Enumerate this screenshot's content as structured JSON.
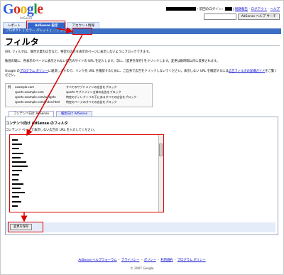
{
  "header": {
    "logo_text_g": "G",
    "logo_text_o1": "o",
    "logo_text_o2": "o",
    "logo_text_g2": "g",
    "logo_text_l": "l",
    "logo_text_e": "e",
    "logo_sub": "AdSense",
    "user_suffix": "・前回のログイン：",
    "links": [
      "問題報告",
      "ログアウト",
      "ヘルプ"
    ],
    "search_button": "AdSense ヘルプ サーチ"
  },
  "tabs": [
    {
      "label": "レポート",
      "active": false
    },
    {
      "label": "AdSense 設定",
      "active": true
    },
    {
      "label": "アカウント情報",
      "active": false
    }
  ],
  "subnav": {
    "items": [
      "プロダクト",
      "カラー パレット",
      "…",
      "フィルタ"
    ],
    "current_index": 3
  },
  "page": {
    "title": "フィルタ",
    "para1": "URL フィルタは、競合企業の広告など、特定の広告を表示のページに表示しないようにブロックできます。",
    "para2": "数週の間に、各表示のページに表示されない広告のサイトの URL を記入します。次に、[変更を保存] をクリックします。変更は数時間以内に反映されます。",
    "para3_lead": "Google の",
    "para3_link1": "プログラム ポリシー",
    "para3_mid": "に違反しますので、リンク先 URL を確認するために、ご自身で広告をクリックしないでください。表示しない URL を確認するには",
    "para3_link2": "広告フィルタの詳細ガイド",
    "para3_tail": "をご覧ください。"
  },
  "examples": {
    "label": "例",
    "rows": [
      {
        "url": "example.com",
        "desc": "すべてのサブドメインの広告をブロック"
      },
      {
        "url": "sports.example.com",
        "desc": "sports サブドメイン全体の広告をブロック"
      },
      {
        "url": "sports.example.com/widgets",
        "desc": "特定のディレクトリの下にあるすべての広告をブロック"
      },
      {
        "url": "sports.example.com/index.html",
        "desc": "特定のページのすべての広告をブロック"
      }
    ]
  },
  "content_tabs": [
    {
      "label": "コンテンツ向け AdSense",
      "active": true
    },
    {
      "label": "検索向け AdSense",
      "active": false
    }
  ],
  "panel": {
    "title": "コンテンツ向け AdSense のフィルタ",
    "instruction": "コンテンツ ページで表示しない広告の URL を入力してください。"
  },
  "save_button": "変更を保存",
  "footer": {
    "links": [
      "AdSense ヘルプフォーラム",
      "プライバシー",
      "ポリシー",
      "利用規約",
      "プログラム ポリシー"
    ],
    "copyright": "© 2007 Google"
  },
  "colors": {
    "annotation_red": "#dd0000",
    "nav_blue": "#3d6fc4",
    "link": "#0000cc"
  }
}
